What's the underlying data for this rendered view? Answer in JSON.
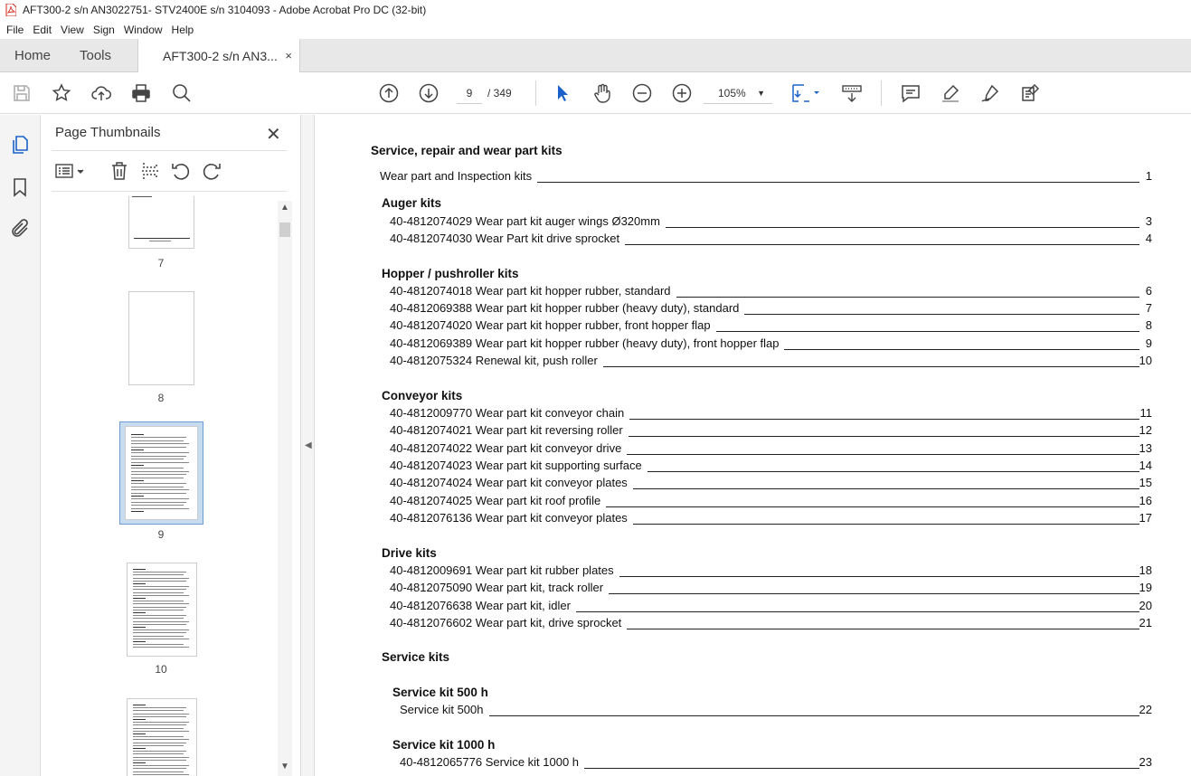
{
  "window": {
    "title": "AFT300-2 s/n AN3022751- STV2400E s/n 3104093 - Adobe Acrobat Pro DC (32-bit)"
  },
  "menu": [
    "File",
    "Edit",
    "View",
    "Sign",
    "Window",
    "Help"
  ],
  "tabs": {
    "home": "Home",
    "tools": "Tools",
    "doc": "AFT300-2 s/n AN3...",
    "close": "×"
  },
  "toolbar": {
    "page_current": "9",
    "page_total": "/ 349",
    "zoom": "105%"
  },
  "panel": {
    "title": "Page Thumbnails",
    "close": "✕",
    "thumbnails": [
      {
        "label": "7"
      },
      {
        "label": "8"
      },
      {
        "label": "9"
      },
      {
        "label": "10"
      },
      {
        "label": ""
      }
    ]
  },
  "toc": {
    "main_title": "Service, repair and wear part kits",
    "sections": [
      {
        "heading": "",
        "items": [
          {
            "text": "Wear part and Inspection kits",
            "page": "1"
          }
        ]
      },
      {
        "heading": "Auger kits",
        "items": [
          {
            "text": "40-4812074029 Wear part kit auger wings Ø320mm",
            "page": "3"
          },
          {
            "text": "40-4812074030 Wear Part kit drive sprocket",
            "page": "4"
          }
        ]
      },
      {
        "heading": "Hopper / pushroller kits",
        "items": [
          {
            "text": "40-4812074018 Wear part kit hopper rubber, standard",
            "page": "6"
          },
          {
            "text": "40-4812069388 Wear part kit hopper rubber (heavy duty), standard",
            "page": "7"
          },
          {
            "text": "40-4812074020 Wear part kit hopper rubber, front hopper flap",
            "page": "8"
          },
          {
            "text": "40-4812069389 Wear part kit hopper rubber (heavy duty), front hopper flap",
            "page": "9"
          },
          {
            "text": "40-4812075324 Renewal kit, push roller",
            "page": "10"
          }
        ]
      },
      {
        "heading": "Conveyor kits",
        "items": [
          {
            "text": "40-4812009770 Wear part kit conveyor chain",
            "page": "11"
          },
          {
            "text": "40-4812074021 Wear part kit reversing roller",
            "page": "12"
          },
          {
            "text": "40-4812074022 Wear part kit conveyor drive",
            "page": "13"
          },
          {
            "text": "40-4812074023 Wear part kit supporting surface",
            "page": "14"
          },
          {
            "text": "40-4812074024 Wear part kit conveyor plates",
            "page": "15"
          },
          {
            "text": "40-4812074025 Wear part kit roof profile",
            "page": "16"
          },
          {
            "text": "40-4812076136 Wear part kit conveyor plates",
            "page": "17"
          }
        ]
      },
      {
        "heading": "Drive kits",
        "items": [
          {
            "text": "40-4812009691 Wear part kit rubber plates",
            "page": "18"
          },
          {
            "text": "40-4812075090 Wear part kit, track roller",
            "page": "19"
          },
          {
            "text": "40-4812076638 Wear part kit, idler",
            "page": "20"
          },
          {
            "text": "40-4812076602 Wear part kit, drive sprocket",
            "page": "21"
          }
        ]
      },
      {
        "heading": "Service kits",
        "items": []
      },
      {
        "heading": "Service kit 500 h",
        "items": [
          {
            "text": "Service kit 500h",
            "page": "22"
          }
        ]
      },
      {
        "heading": "Service kit 1000 h",
        "items": [
          {
            "text": "40-4812065776 Service kit 1000 h",
            "page": "23"
          }
        ]
      }
    ]
  }
}
